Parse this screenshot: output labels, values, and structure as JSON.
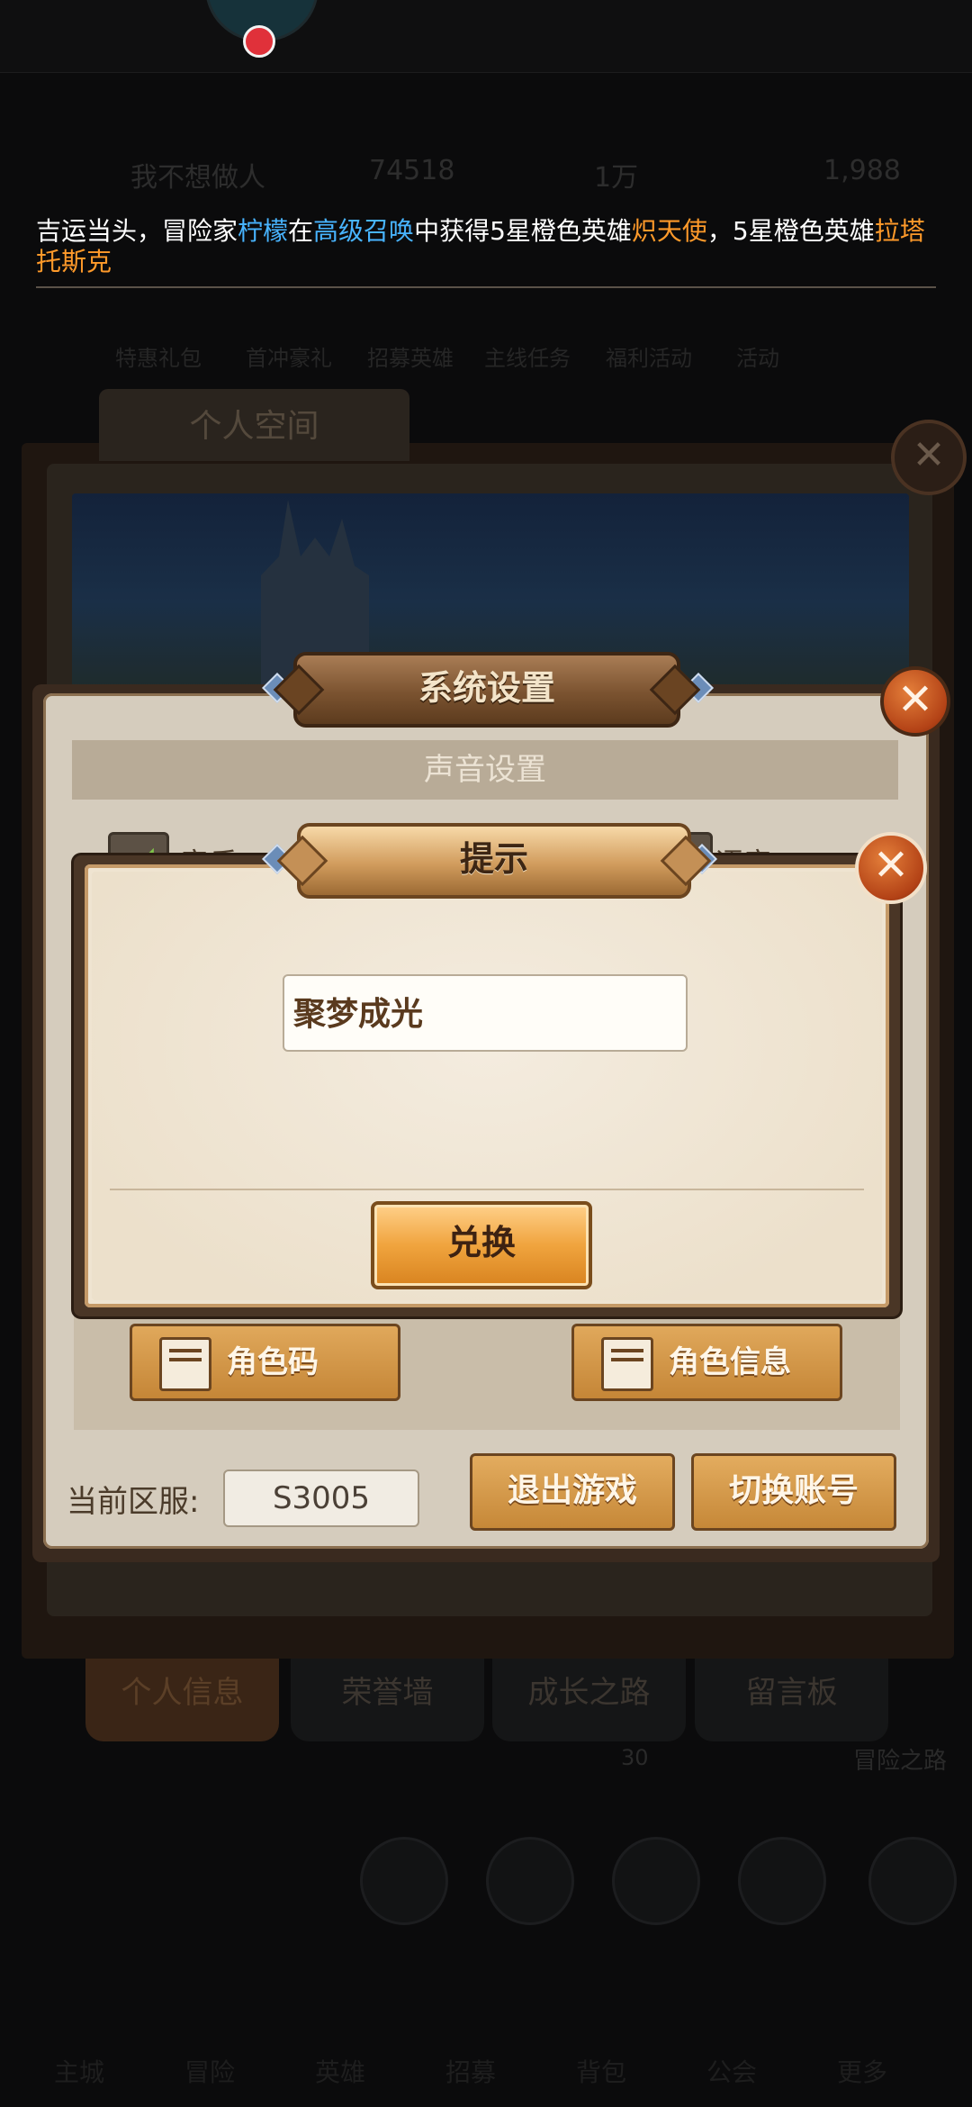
{
  "background": {
    "stats": {
      "name": "我不想做人",
      "power": "74518",
      "gold": "1万",
      "gems": "1,988"
    },
    "menu_labels": [
      "特惠礼包",
      "首冲豪礼",
      "招募英雄",
      "主线任务",
      "福利活动",
      "活动"
    ],
    "panel_tab": "个人空间",
    "bottom_tabs": [
      "个人信息",
      "荣誉墙",
      "成长之路",
      "留言板"
    ],
    "progress_text": "30",
    "side_label": "冒险之路",
    "dock_labels": [
      "主城",
      "冒险",
      "英雄",
      "招募",
      "背包",
      "公会",
      "更多"
    ]
  },
  "ticker": {
    "p1": "吉运当头，冒险家",
    "player": "柠檬",
    "p2": "在",
    "event": "高级召唤",
    "p3": "中获得5星橙色英雄",
    "hero1": "炽天使",
    "p4": "，5星橙色英雄",
    "hero2": "拉塔托斯克"
  },
  "settings": {
    "title": "系统设置",
    "sound_section": "声音设置",
    "music_label": "音乐",
    "voice_label": "语音",
    "role_code_button": "角色码",
    "role_info_button": "角色信息",
    "server_label": "当前区服:",
    "server_value": "S3005",
    "exit_button": "退出游戏",
    "switch_button": "切换账号"
  },
  "tip_dialog": {
    "title": "提示",
    "code_value": "聚梦成光",
    "redeem_button": "兑换"
  },
  "colors": {
    "ticker_player": "#48b4ff",
    "ticker_hero": "#ff9a2a",
    "button_orange": "#f0a43e"
  }
}
